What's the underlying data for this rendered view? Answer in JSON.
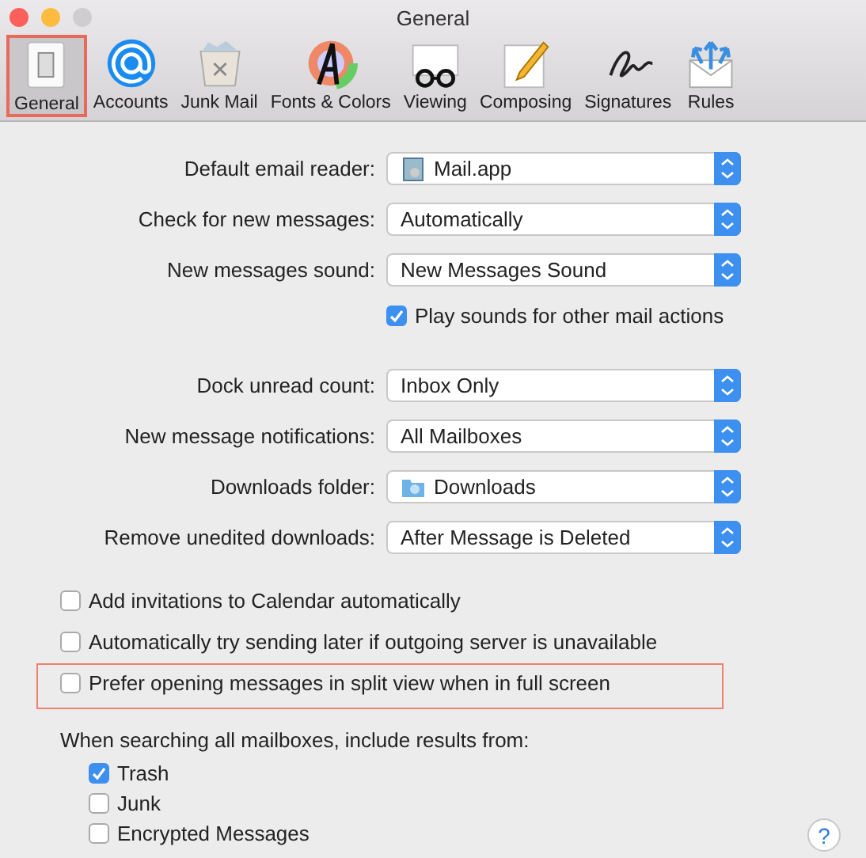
{
  "window": {
    "title": "General"
  },
  "toolbar": [
    {
      "label": "General",
      "selected": true,
      "highlighted": true
    },
    {
      "label": "Accounts",
      "selected": false,
      "highlighted": false
    },
    {
      "label": "Junk Mail",
      "selected": false,
      "highlighted": false
    },
    {
      "label": "Fonts & Colors",
      "selected": false,
      "highlighted": false
    },
    {
      "label": "Viewing",
      "selected": false,
      "highlighted": false
    },
    {
      "label": "Composing",
      "selected": false,
      "highlighted": false
    },
    {
      "label": "Signatures",
      "selected": false,
      "highlighted": false
    },
    {
      "label": "Rules",
      "selected": false,
      "highlighted": false
    }
  ],
  "settings": [
    {
      "kind": "popup",
      "label": "Default email reader:",
      "value": "Mail.app"
    },
    {
      "kind": "popup",
      "label": "Check for new messages:",
      "value": "Automatically"
    },
    {
      "kind": "popup",
      "label": "New messages sound:",
      "value": "New Messages Sound"
    },
    {
      "kind": "checkbox",
      "label": "Play sounds for other mail actions",
      "checked": true
    },
    {
      "kind": "gap"
    },
    {
      "kind": "popup",
      "label": "Dock unread count:",
      "value": "Inbox Only"
    },
    {
      "kind": "popup",
      "label": "New message notifications:",
      "value": "All Mailboxes"
    },
    {
      "kind": "popup",
      "label": "Downloads folder:",
      "value": "Downloads"
    },
    {
      "kind": "popup",
      "label": "Remove unedited downloads:",
      "value": "After Message is Deleted"
    }
  ],
  "options": [
    {
      "label": "Add invitations to Calendar automatically",
      "checked": false,
      "highlighted": false
    },
    {
      "label": "Automatically try sending later if outgoing server is unavailable",
      "checked": false,
      "highlighted": false
    },
    {
      "label": "Prefer opening messages in split view when in full screen",
      "checked": false,
      "highlighted": true
    }
  ],
  "search_heading": "When searching all mailboxes, include results from:",
  "search_sources": [
    {
      "label": "Trash",
      "checked": true
    },
    {
      "label": "Junk",
      "checked": false
    },
    {
      "label": "Encrypted Messages",
      "checked": false
    }
  ],
  "help_button": "?"
}
